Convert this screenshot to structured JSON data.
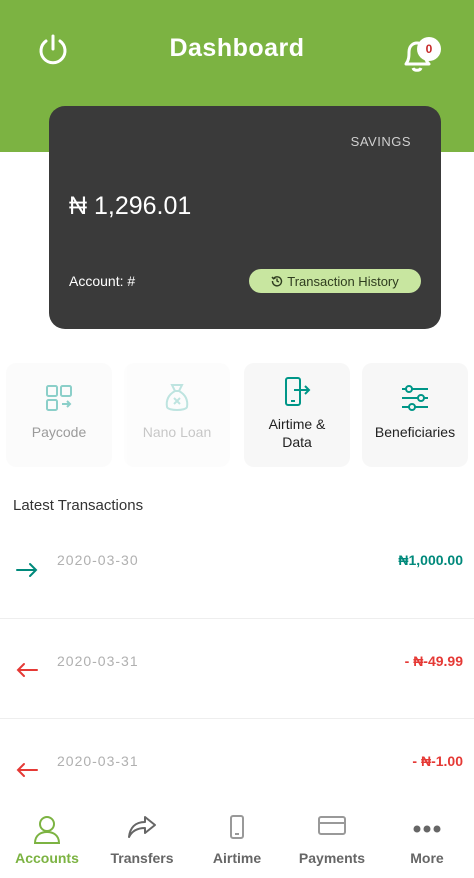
{
  "header": {
    "title": "Dashboard",
    "notification_count": "0",
    "background": "#7cb342"
  },
  "card": {
    "account_type": "SAVINGS",
    "balance": "₦ 1,296.01",
    "account_label": "Account: #",
    "history_button": "Transaction History"
  },
  "tiles": [
    {
      "label": "Paycode",
      "icon": "paycode-icon"
    },
    {
      "label": "Nano Loan",
      "icon": "money-bag-icon"
    },
    {
      "label": "Airtime & Data",
      "icon": "phone-exit-icon"
    },
    {
      "label": "Beneficiaries",
      "icon": "sliders-icon"
    }
  ],
  "transactions": {
    "title": "Latest Transactions",
    "items": [
      {
        "date": "2020-03-30",
        "amount": "₦1,000.00",
        "direction": "credit"
      },
      {
        "date": "2020-03-31",
        "amount": "- ₦-49.99",
        "direction": "debit"
      },
      {
        "date": "2020-03-31",
        "amount": "- ₦-1.00",
        "direction": "debit"
      }
    ]
  },
  "nav": {
    "items": [
      {
        "label": "Accounts",
        "icon": "user-icon",
        "active": true
      },
      {
        "label": "Transfers",
        "icon": "share-arrow-icon"
      },
      {
        "label": "Airtime",
        "icon": "mobile-icon"
      },
      {
        "label": "Payments",
        "icon": "credit-card-icon"
      },
      {
        "label": "More",
        "icon": "more-dots-icon"
      }
    ]
  }
}
